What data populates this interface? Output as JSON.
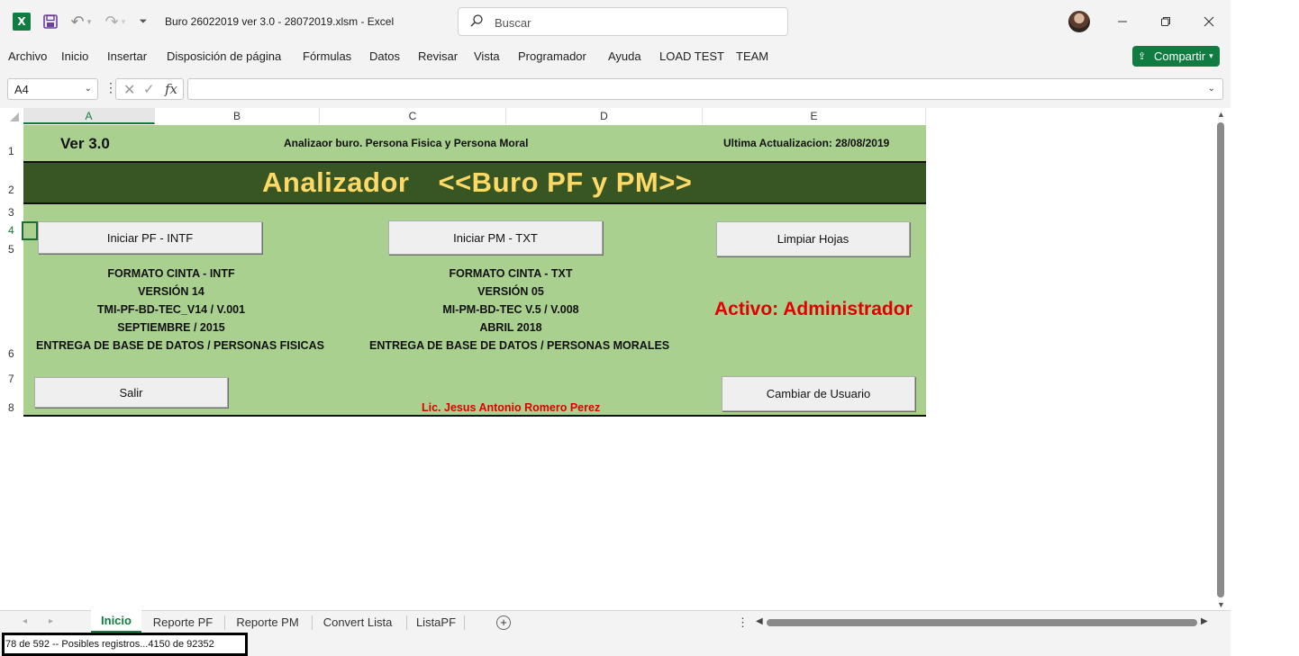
{
  "app": {
    "doc_title": "Buro 26022019 ver 3.0 - 28072019.xlsm  -  Excel",
    "search_placeholder": "Buscar",
    "share_label": "Compartir"
  },
  "menu": [
    "Archivo",
    "Inicio",
    "Insertar",
    "Disposición de página",
    "Fórmulas",
    "Datos",
    "Revisar",
    "Vista",
    "Programador",
    "Ayuda",
    "LOAD TEST",
    "TEAM"
  ],
  "formula_bar": {
    "name_box": "A4",
    "formula": "",
    "fx_label": "fx"
  },
  "columns": [
    "A",
    "B",
    "C",
    "D",
    "E"
  ],
  "active_column": "A",
  "rows": [
    "1",
    "2",
    "3",
    "4",
    "5",
    "6",
    "7",
    "8"
  ],
  "active_row": "4",
  "sheet": {
    "version": "Ver 3.0",
    "subtitle": "Analizaor buro. Persona Fisica y Persona Moral",
    "last_update": "Ultima Actualizacion: 28/08/2019",
    "title_left": "Analizador",
    "title_right": "<<Buro PF y PM>>",
    "buttons": {
      "iniciar_pf": "Iniciar PF - INTF",
      "iniciar_pm": "Iniciar PM - TXT",
      "limpiar": "Limpiar Hojas",
      "salir": "Salir",
      "cambiar_usuario": "Cambiar de Usuario"
    },
    "pf_info": [
      "FORMATO CINTA - INTF",
      "VERSIÓN 14",
      "TMI-PF-BD-TEC_V14 / V.001",
      "SEPTIEMBRE / 2015",
      "ENTREGA DE BASE DE DATOS / PERSONAS FISICAS"
    ],
    "pm_info": [
      "FORMATO CINTA - TXT",
      "VERSIÓN 05",
      "MI-PM-BD-TEC V.5 / V.008",
      "ABRIL 2018",
      "ENTREGA DE BASE DE DATOS / PERSONAS MORALES"
    ],
    "active_user": "Activo: Administrador",
    "author": "Lic. Jesus Antonio Romero Perez"
  },
  "tabs": [
    "Inicio",
    "Reporte PF",
    "Reporte PM",
    "Convert Lista",
    "ListaPF"
  ],
  "active_tab": "Inicio",
  "status": "78 de 592 -- Posibles registros...4150 de 92352",
  "colors": {
    "excel_green": "#107c41",
    "sheet_green": "#a9d08e",
    "band_dark_green": "#375623",
    "title_yellow": "#ffd966",
    "alert_red": "#e00000"
  }
}
